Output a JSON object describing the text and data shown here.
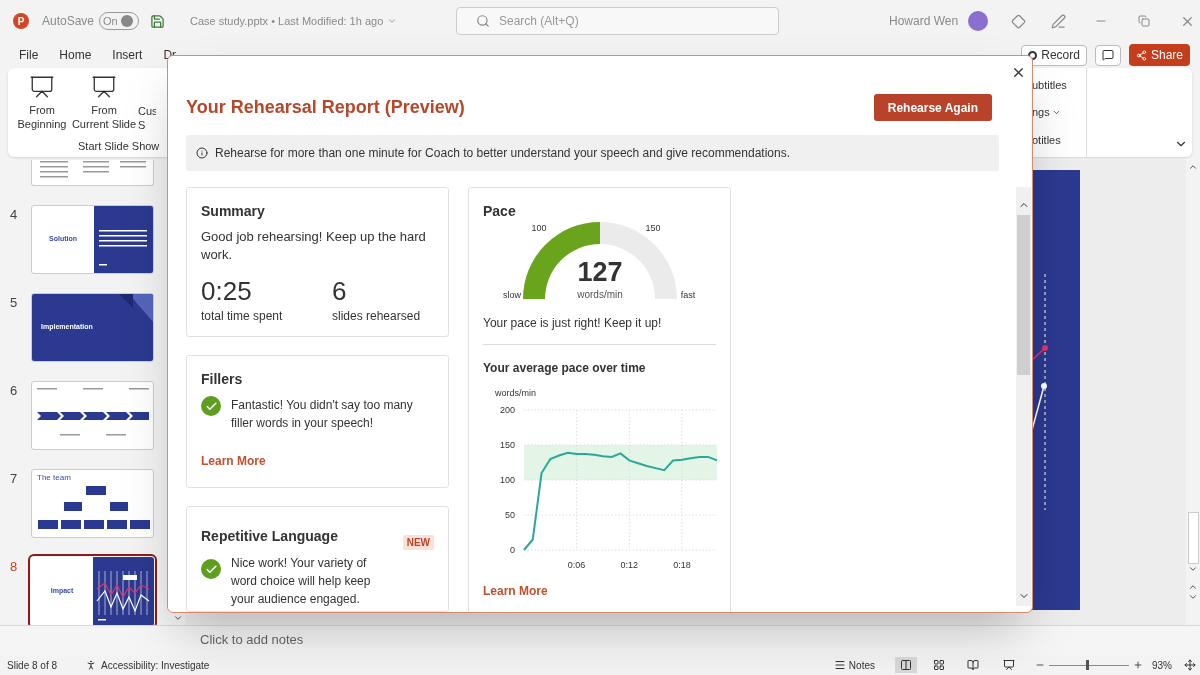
{
  "title_bar": {
    "app_logo": "P",
    "autosave_label": "AutoSave",
    "autosave": {
      "label": "On",
      "on": true
    },
    "document": "Case study.pptx • Last Modified: 1h ago",
    "search": {
      "placeholder": "Search (Alt+Q)"
    },
    "user": "Howard Wen"
  },
  "menu_tabs": [
    "File",
    "Home",
    "Insert",
    "Dr"
  ],
  "header_buttons": {
    "record": "Record",
    "share": "Share"
  },
  "ribbon": {
    "buttons": [
      {
        "lines": [
          "From",
          "Beginning"
        ]
      },
      {
        "lines": [
          "From",
          "Current Slide"
        ]
      },
      {
        "lines": [
          "Cus",
          "S"
        ]
      }
    ],
    "group_label": "Start Slide Show",
    "right_items": [
      {
        "label": "ubtitles",
        "dropdown": false
      },
      {
        "label": "ngs",
        "dropdown": true
      },
      {
        "label": "otitles",
        "dropdown": false
      }
    ]
  },
  "slides": [
    {
      "kind": "text",
      "selected": false
    },
    {
      "number": "4",
      "kind": "split",
      "title": "Solution",
      "selected": false
    },
    {
      "number": "5",
      "kind": "title",
      "title": "Implementation",
      "selected": false
    },
    {
      "number": "6",
      "kind": "timeline",
      "selected": false
    },
    {
      "number": "7",
      "kind": "org",
      "title": "The team",
      "selected": false
    },
    {
      "number": "8",
      "kind": "split_chart",
      "title": "Impact",
      "selected": true
    }
  ],
  "notes": {
    "placeholder": "Click to add notes"
  },
  "dialog": {
    "title": "Your Rehearsal Report (Preview)",
    "action": "Rehearse Again",
    "notice": "Rehearse for more than one minute for Coach to better understand your speech and give recommendations.",
    "summary": {
      "title": "Summary",
      "message": "Good job rehearsing! Keep up the hard work.",
      "stats": [
        {
          "value": "0:25",
          "label": "total time spent"
        },
        {
          "value": "6",
          "label": "slides rehearsed"
        }
      ]
    },
    "fillers": {
      "title": "Fillers",
      "message": "Fantastic! You didn't say too many filler words in your speech!",
      "link": "Learn More"
    },
    "repetitive": {
      "title": "Repetitive Language",
      "badge": "NEW",
      "message": "Nice work! Your variety of word choice will help keep your audience engaged."
    },
    "pace": {
      "title": "Pace",
      "gauge": {
        "value": "127",
        "unit": "words/min",
        "min_label": "slow",
        "max_label": "fast",
        "low_tick": "100",
        "high_tick": "150",
        "level": 0.5
      },
      "message": "Your pace is just right! Keep it up!",
      "chart_title": "Your average pace over time",
      "chart_data": {
        "type": "line",
        "ylabel": "words/min",
        "x": [
          0,
          1,
          2,
          3,
          4,
          5,
          6,
          7,
          8,
          9,
          10,
          11,
          12,
          13,
          14,
          15,
          16,
          17,
          18,
          19,
          20,
          21,
          22
        ],
        "values": [
          0,
          15,
          110,
          130,
          135,
          139,
          137,
          137,
          136,
          134,
          133,
          138,
          128,
          124,
          120,
          117,
          114,
          128,
          129,
          131,
          133,
          133,
          128
        ],
        "xlim": [
          0,
          22
        ],
        "ylim": [
          0,
          200
        ],
        "yticks": [
          0,
          50,
          100,
          150,
          200
        ],
        "xticks": [
          {
            "value": 6,
            "label": "0:06"
          },
          {
            "value": 12,
            "label": "0:12"
          },
          {
            "value": 18,
            "label": "0:18"
          }
        ],
        "grid": true,
        "bands": [
          {
            "axis": "y",
            "from": 100,
            "to": 150
          }
        ]
      },
      "link": "Learn More"
    }
  },
  "status_bar": {
    "slide": "Slide 8 of 8",
    "accessibility": "Accessibility: Investigate",
    "notes": "Notes",
    "zoom": "93%",
    "zoom_slider": {
      "level": 0.48
    }
  }
}
